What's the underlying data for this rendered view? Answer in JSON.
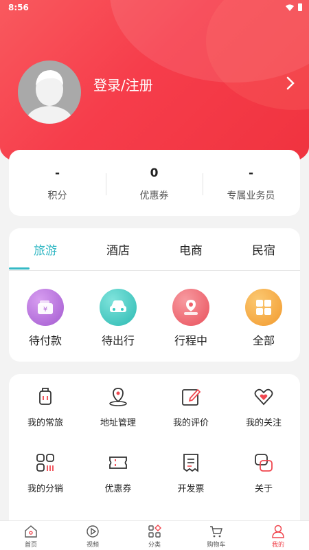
{
  "status_bar": {
    "time": "8:56"
  },
  "profile": {
    "login_label": "登录/注册"
  },
  "stats": [
    {
      "value": "-",
      "label": "积分"
    },
    {
      "value": "0",
      "label": "优惠券"
    },
    {
      "value": "-",
      "label": "专属业务员"
    }
  ],
  "order_tabs": [
    {
      "label": "旅游",
      "active": true
    },
    {
      "label": "酒店",
      "active": false
    },
    {
      "label": "电商",
      "active": false
    },
    {
      "label": "民宿",
      "active": false
    }
  ],
  "order_items": [
    {
      "label": "待付款",
      "icon": "wallet-icon",
      "color": "#b56ad9"
    },
    {
      "label": "待出行",
      "icon": "car-icon",
      "color": "#36c8c0"
    },
    {
      "label": "行程中",
      "icon": "location-icon",
      "color": "#f0606b"
    },
    {
      "label": "全部",
      "icon": "grid-icon",
      "color": "#f5a23a"
    }
  ],
  "services": [
    {
      "label": "我的常旅",
      "icon": "luggage-icon"
    },
    {
      "label": "地址管理",
      "icon": "map-pin-icon"
    },
    {
      "label": "我的评价",
      "icon": "edit-icon"
    },
    {
      "label": "我的关注",
      "icon": "heart-icon"
    },
    {
      "label": "我的分销",
      "icon": "apps-icon"
    },
    {
      "label": "优惠券",
      "icon": "coupon-icon"
    },
    {
      "label": "开发票",
      "icon": "receipt-icon"
    },
    {
      "label": "关于",
      "icon": "about-icon"
    }
  ],
  "bottom_nav": [
    {
      "label": "首页",
      "icon": "home-icon"
    },
    {
      "label": "视频",
      "icon": "play-icon"
    },
    {
      "label": "分类",
      "icon": "category-icon"
    },
    {
      "label": "购物车",
      "icon": "cart-icon"
    },
    {
      "label": "我的",
      "icon": "user-icon",
      "active": true
    }
  ],
  "colors": {
    "brand": "#f63d4b",
    "accent_tab": "#35b9c5",
    "service_icon": "#333333",
    "service_icon_accent": "#f0474f"
  }
}
